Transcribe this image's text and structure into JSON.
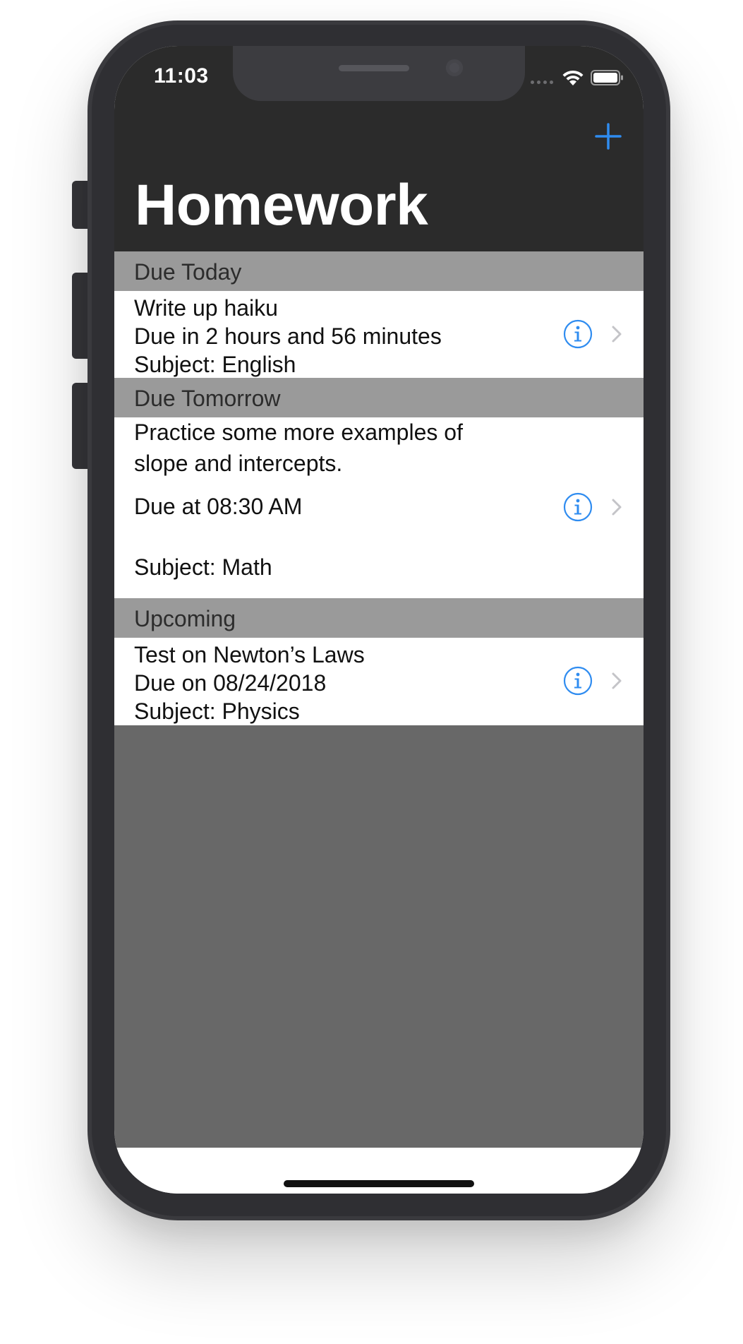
{
  "status_bar": {
    "time": "11:03"
  },
  "nav": {
    "title": "Homework",
    "add_icon": "plus-icon",
    "accent_color": "#2f8cf0"
  },
  "sections": [
    {
      "header": "Due Today",
      "items": [
        {
          "title": "Write up haiku",
          "due": "Due in 2 hours and 56 minutes",
          "subject": "Subject: English"
        }
      ]
    },
    {
      "header": "Due Tomorrow",
      "items": [
        {
          "title": "Practice some more examples of slope and intercepts.",
          "due": "Due at 08:30 AM",
          "subject": "Subject: Math"
        }
      ]
    },
    {
      "header": "Upcoming",
      "items": [
        {
          "title": "Test on Newton’s Laws",
          "due": "Due on 08/24/2018",
          "subject": "Subject: Physics"
        }
      ]
    }
  ],
  "icons": {
    "info": "info-icon",
    "chevron": "chevron-right-icon",
    "wifi": "wifi-icon",
    "battery": "battery-icon"
  }
}
